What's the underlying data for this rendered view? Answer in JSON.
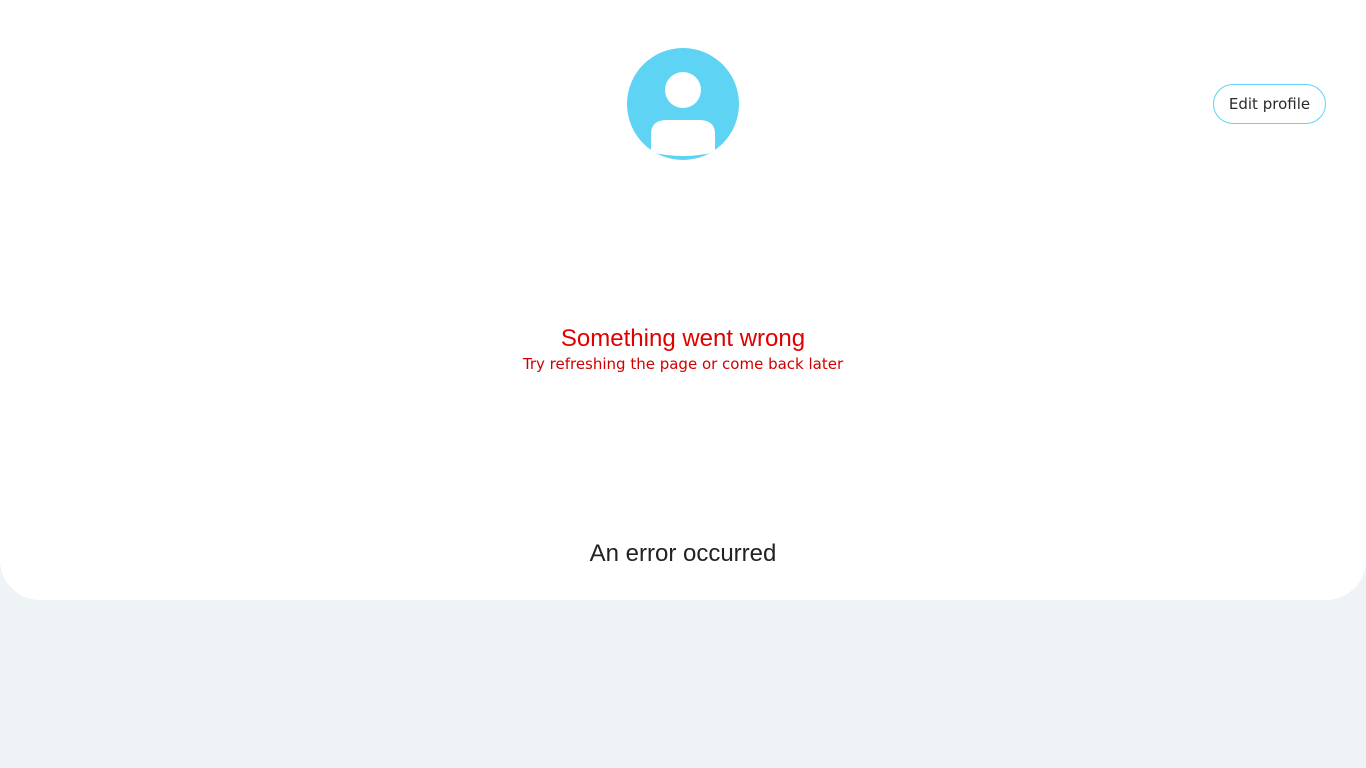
{
  "profile": {
    "avatar_icon": "user-avatar-icon",
    "avatar_color": "#5fd3f3",
    "edit_button_label": "Edit profile"
  },
  "error": {
    "title": "Something went wrong",
    "subtitle": "Try refreshing the page or come back later",
    "color": "#e00000"
  },
  "footer": {
    "message": "An error occurred"
  }
}
